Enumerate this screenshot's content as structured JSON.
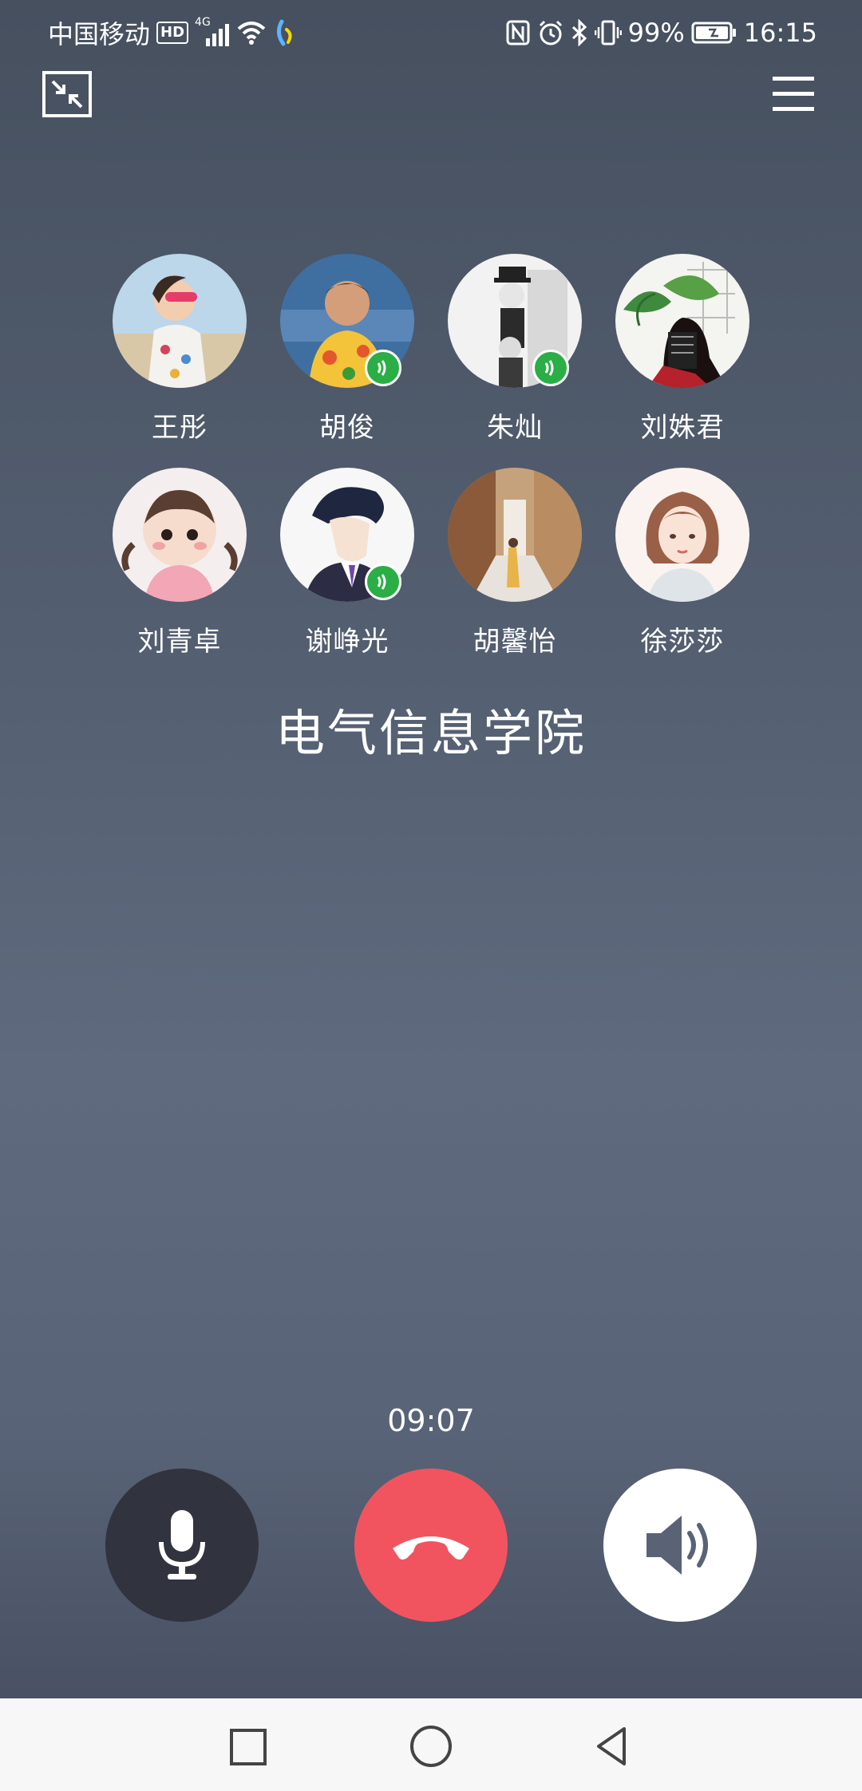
{
  "status_bar": {
    "carrier": "中国移动",
    "hd": "HD",
    "network": "4G",
    "battery_percent": "99%",
    "time": "16:15"
  },
  "participants": [
    {
      "name": "王彤",
      "speaking": false
    },
    {
      "name": "胡俊",
      "speaking": true
    },
    {
      "name": "朱灿",
      "speaking": true
    },
    {
      "name": "刘姝君",
      "speaking": false
    },
    {
      "name": "刘青卓",
      "speaking": false
    },
    {
      "name": "谢峥光",
      "speaking": true
    },
    {
      "name": "胡馨怡",
      "speaking": false
    },
    {
      "name": "徐莎莎",
      "speaking": false
    }
  ],
  "group_name": "电气信息学院",
  "call_timer": "09:07",
  "colors": {
    "hangup": "#f2545f",
    "mic_bg": "#31343f",
    "speaker_bg": "#ffffff",
    "speaking_indicator": "#2aae45"
  }
}
